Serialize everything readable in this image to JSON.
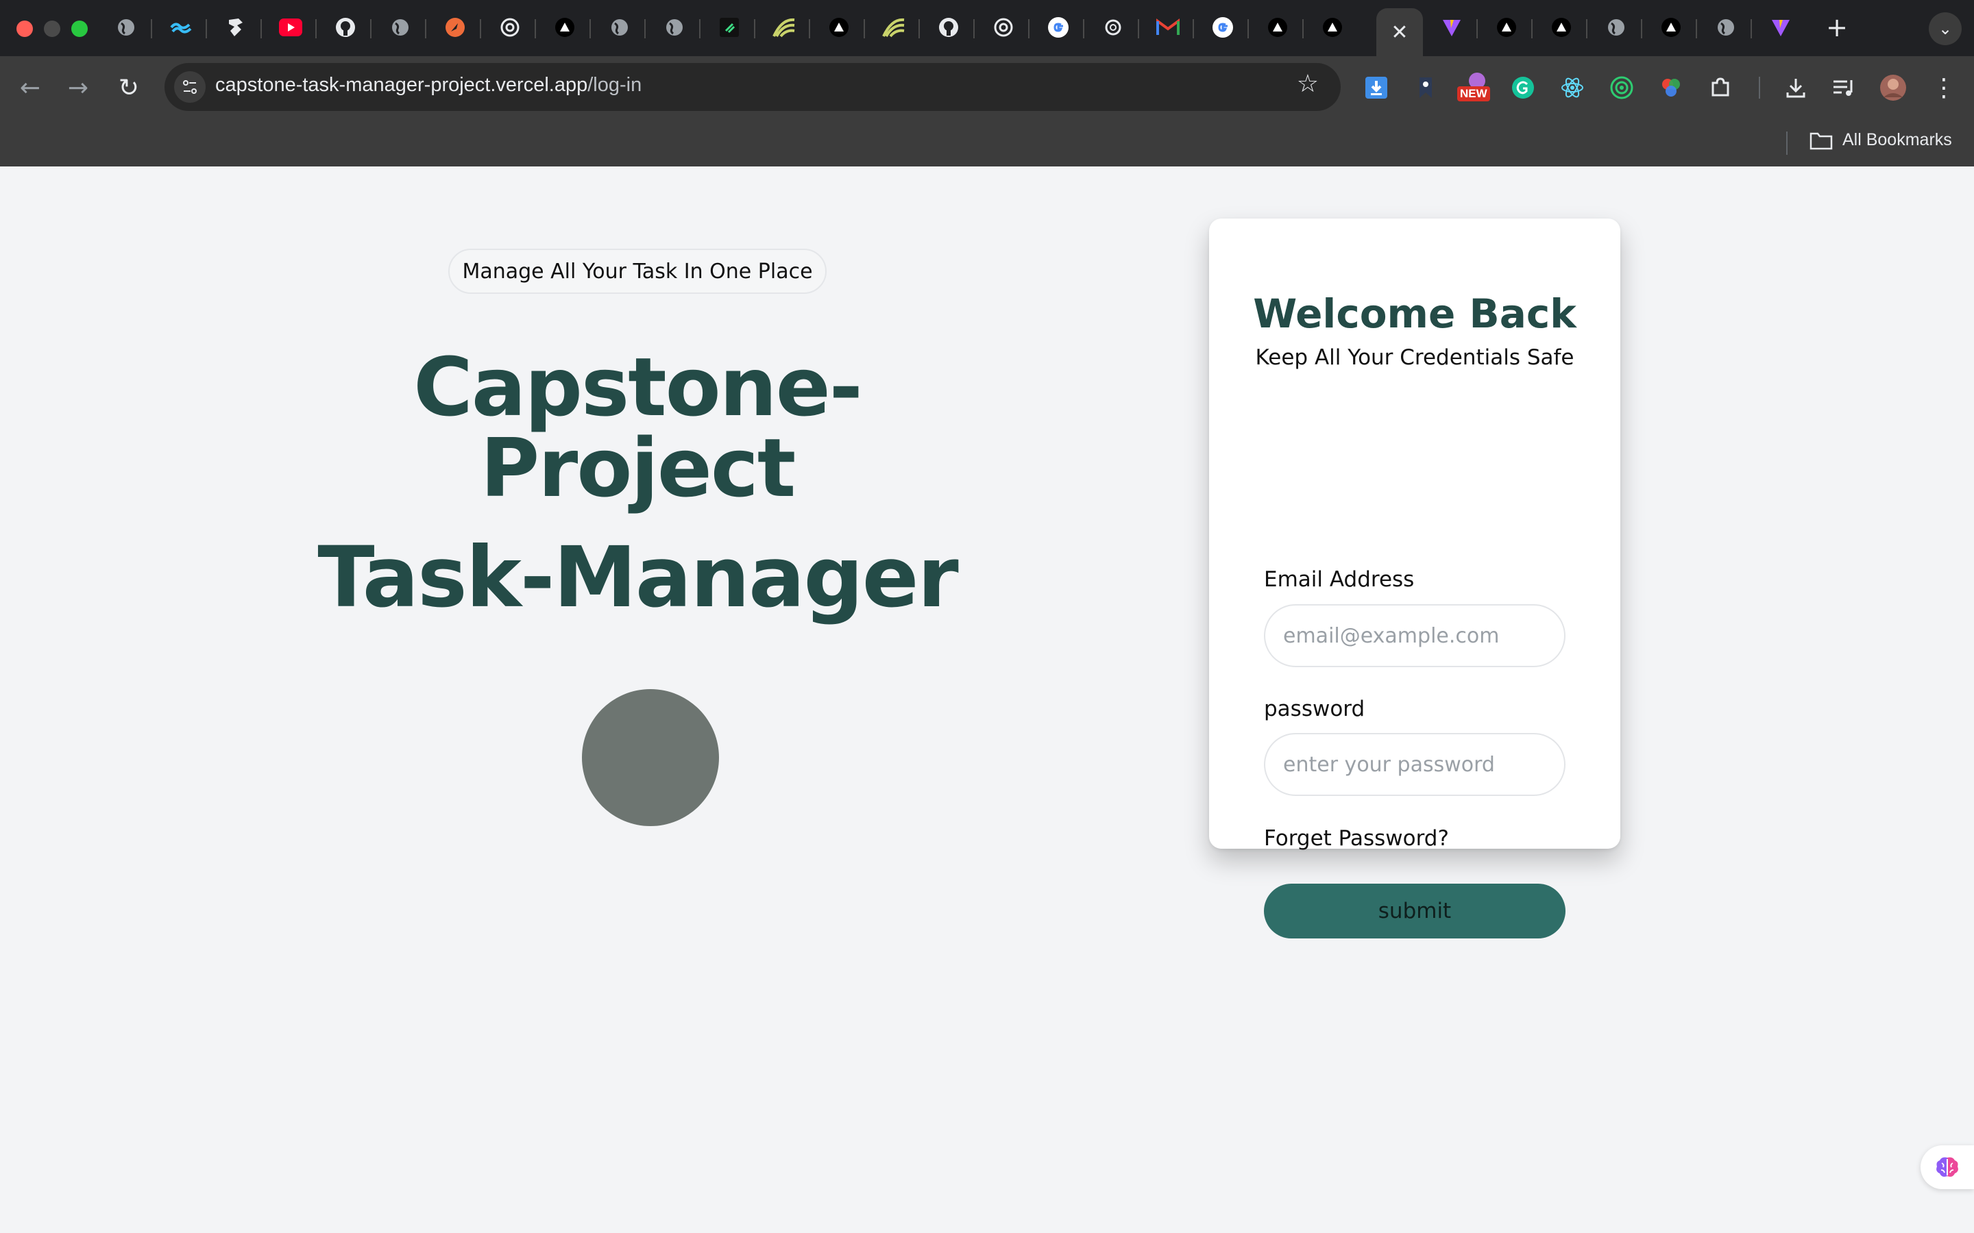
{
  "browser": {
    "address": {
      "host": "capstone-task-manager-project.vercel.app",
      "path": "/log-in"
    },
    "close_tab_glyph": "✕",
    "new_tab_glyph": "+",
    "tab_menu_glyph": "⌄",
    "back_glyph": "←",
    "forward_glyph": "→",
    "reload_glyph": "↻",
    "star_glyph": "☆",
    "menu_glyph": "⋮",
    "extension_badge": "NEW",
    "bookmarks_label": "All Bookmarks"
  },
  "hero": {
    "tagline": "Manage All Your Task In One Place",
    "title_line1": "Capstone-",
    "title_line2": "Project",
    "title_line3": "Task-Manager"
  },
  "login": {
    "heading": "Welcome Back",
    "subheading": "Keep All Your Credentials Safe",
    "email_label": "Email Address",
    "email_placeholder": "email@example.com",
    "password_label": "password",
    "password_placeholder": "enter your password",
    "forgot_link": "Forget Password?",
    "submit_label": "submit"
  },
  "colors": {
    "accent_dark": "#244b47",
    "button": "#2f6e68",
    "page_background": "#f3f4f6"
  }
}
